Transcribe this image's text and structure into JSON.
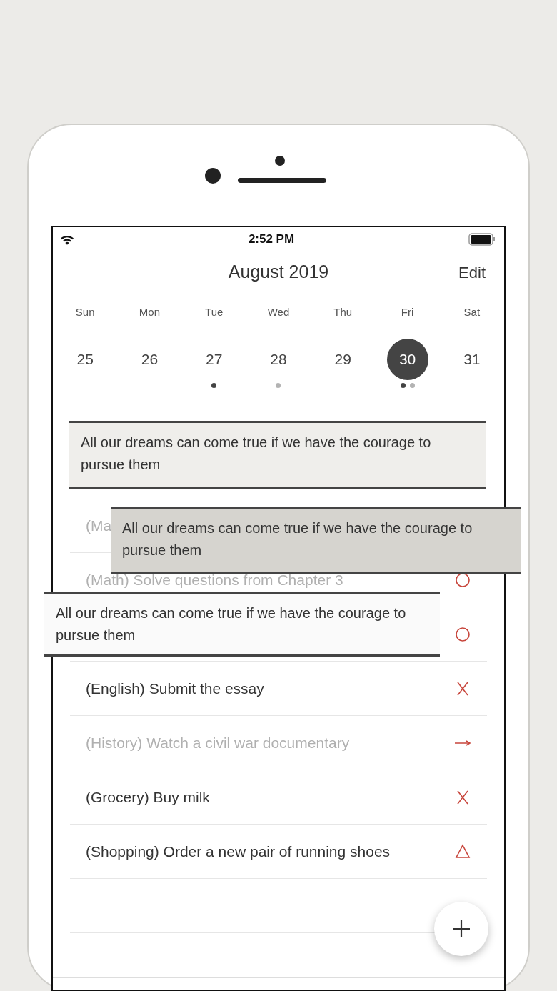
{
  "status_bar": {
    "time": "2:52 PM"
  },
  "header": {
    "title": "August 2019",
    "edit": "Edit"
  },
  "week": [
    {
      "day": "Sun",
      "date": "25",
      "selected": false
    },
    {
      "day": "Mon",
      "date": "26",
      "selected": false
    },
    {
      "day": "Tue",
      "date": "27",
      "selected": false,
      "dots": [
        {
          "color": "#444444"
        }
      ]
    },
    {
      "day": "Wed",
      "date": "28",
      "selected": false,
      "dots": [
        {
          "color": "#b3b3b3"
        }
      ]
    },
    {
      "day": "Thu",
      "date": "29",
      "selected": false
    },
    {
      "day": "Fri",
      "date": "30",
      "selected": true,
      "dots": [
        {
          "color": "#444444"
        },
        {
          "color": "#b3b3b3"
        }
      ]
    },
    {
      "day": "Sat",
      "date": "31",
      "selected": false
    }
  ],
  "tasks": [
    {
      "text": "(Ma",
      "done": true
    },
    {
      "text": "(Math) Solve questions from Chapter 3",
      "done": true,
      "kind": "circle"
    },
    {
      "kind": "circle"
    },
    {
      "text": "(English) Submit the essay",
      "done": false,
      "kind": "cross"
    },
    {
      "text": "(History) Watch a civil war documentary",
      "done": true,
      "kind": "arrow"
    },
    {
      "text": "(Grocery) Buy milk",
      "done": false,
      "kind": "cross"
    },
    {
      "text": "(Shopping) Order a new pair of running shoes",
      "done": false,
      "kind": "triangle"
    }
  ],
  "quotes": [
    {
      "text": "All our dreams can come true if we have the courage to pursue them",
      "color": "#efeeeb"
    },
    {
      "text": "All our dreams can come true if we have the courage to pursue them",
      "color": "#d6d4cf"
    },
    {
      "text": "All our dreams can come true if we have the courage to pursue them",
      "color": "#fafafa"
    }
  ]
}
